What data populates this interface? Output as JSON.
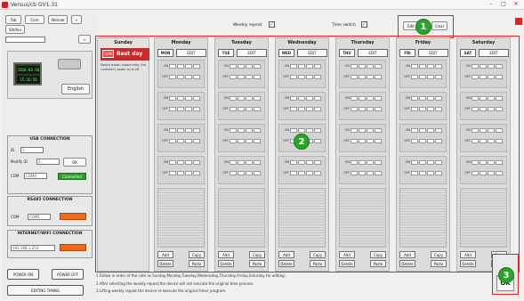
{
  "window": {
    "title": "Versus/cb GV1.31",
    "min": "–",
    "max": "□",
    "close": "✕"
  },
  "left": {
    "menu": [
      "Tab",
      "Core",
      "Weinae",
      "«"
    ],
    "tab3": "Sitefon",
    "lcd_line1": "2016-03-10",
    "lcd_line2": "15:32:56",
    "lang_btn": "English",
    "usb": {
      "title": "USB CONNECTION",
      "id_label": "ID",
      "id_value": "1",
      "modify_label": "Modify ID",
      "modify_value": "2",
      "ok": "OK",
      "com_label": "COM",
      "com_value": "COM4",
      "connect": "Connected"
    },
    "rs485": {
      "title": "RS485 CONNECTION",
      "com_label": "COM",
      "com_value": "COM1"
    },
    "internet": {
      "title": "INTERNET/WIFI CONNECTION",
      "ip": "192.168.1.254"
    },
    "power_on": "POWER ON",
    "power_off": "POWER OFF",
    "editing": "EDITING TIMING"
  },
  "top": {
    "weekly_repeat": "Weekly repeat",
    "time_switch": "Time switch",
    "btn_a": "Edit",
    "btn_b": "Clear"
  },
  "badges": [
    "1",
    "2",
    "3"
  ],
  "sunday": {
    "title": "Sunday",
    "sun_tag": "SUN",
    "rest": "Rest day",
    "note": "Device allows, output relay, this controller's power on or off."
  },
  "days": [
    {
      "title": "Monday",
      "tag": "MON"
    },
    {
      "title": "Tuesday",
      "tag": "TUE"
    },
    {
      "title": "Wednesday",
      "tag": "WED"
    },
    {
      "title": "Thursday",
      "tag": "THU"
    },
    {
      "title": "Friday",
      "tag": "FRI"
    },
    {
      "title": "Saturday",
      "tag": "SAT"
    }
  ],
  "edit_label": "EDIT",
  "on_label": "ON",
  "off_label": "OFF",
  "add_label": "Add",
  "copy_label": "Copy",
  "delete_label": "Delete",
  "paste_label": "Paste",
  "notes": [
    "1.Follow in order of the cate as Sunday,Monday,Tuesday,Wednesday,Thursday,Friday,Saturday for editing.",
    "2.After selecting the weekly repeat,the device will not execute the original time process.",
    "3.Lifting weekly repeat,the device re-execute the original timer program."
  ],
  "ok_label": "OK"
}
